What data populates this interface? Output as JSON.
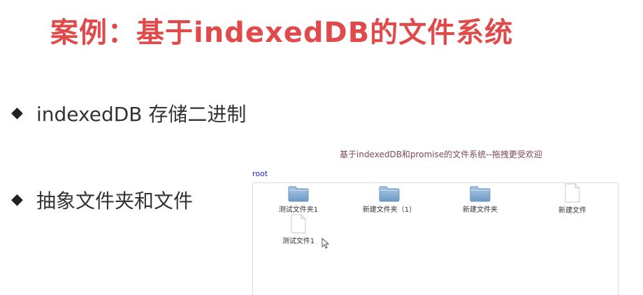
{
  "slide": {
    "title": "案例：基于indexedDB的文件系统",
    "bullets": [
      {
        "text": "indexedDB 存储二进制"
      },
      {
        "text": "抽象文件夹和文件"
      }
    ]
  },
  "demo": {
    "heading": "基于indexedDB和promise的文件系统--拖拽更受欢迎",
    "breadcrumb": "root",
    "items": [
      {
        "type": "folder",
        "icon": "folder-icon",
        "name": "测试文件夹1"
      },
      {
        "type": "folder",
        "icon": "folder-icon",
        "name": "新建文件夹（1）"
      },
      {
        "type": "folder",
        "icon": "folder-icon",
        "name": "新建文件夹"
      },
      {
        "type": "file",
        "icon": "file-icon",
        "name": "新建文件"
      },
      {
        "type": "file",
        "icon": "file-icon",
        "name": "测试文件1"
      }
    ]
  },
  "colors": {
    "title": "#e04a4a",
    "link": "#2121c8",
    "folder": "#7ea8cf"
  }
}
